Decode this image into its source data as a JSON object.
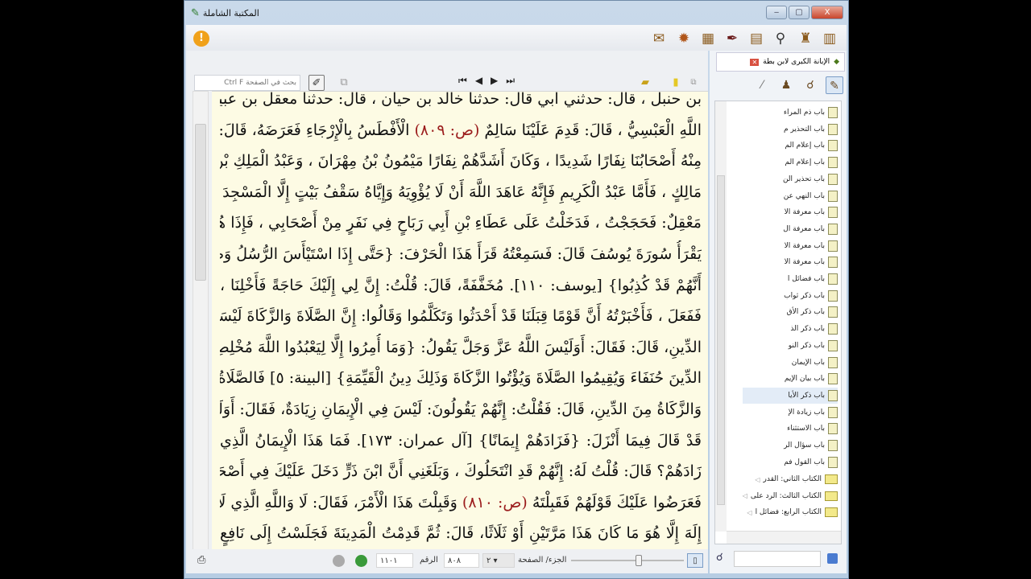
{
  "window": {
    "title": "المكتبة الشاملة",
    "controls": [
      "‒",
      "▢",
      "X"
    ]
  },
  "toolbar": {
    "icons": [
      "library-icon",
      "books-icon",
      "search-icon",
      "document-icon",
      "quill-icon",
      "index-icon",
      "settings-gear-icon",
      "notes-icon"
    ],
    "alert": "!"
  },
  "content_toolbar": {
    "search_placeholder": "بحث في الصفحة Ctrl F",
    "nav": [
      "⏮",
      "◀",
      "▶",
      "⏭"
    ]
  },
  "text_lines": [
    [
      {
        "t": "بن حنبل ، قال: حدثني أبي قال: حدثنا خالد بن حيان ، قال: حدثنا معقل بن عبيد"
      }
    ],
    [
      {
        "t": "اللَّهِ الْعَبْسِيُّ ، قَالَ: قَدِمَ عَلَيْنَا سَالِمٌ "
      },
      {
        "t": "(ص: ٨٠٩)",
        "red": true
      },
      {
        "t": " الْأَفْطَسُ بِالْإِرْجَاءِ فَعَرَضَهُ، قَالَ: فَنَفَرَ"
      }
    ],
    [
      {
        "t": "مِنْهُ أَصْحَابُنَا نِفَارًا شَدِيدًا ، وَكَانَ أَشَدَّهُمْ نِفَارًا مَيْمُونُ بْنُ مِهْرَانَ ، وَعَبْدُ الْمَلِكِ بْنُ"
      }
    ],
    [
      {
        "t": "مَالِكٍ ، فَأَمَّا عَبْدُ الْكَرِيمِ فَإِنَّهُ عَاهَدَ اللَّهَ أَنْ لَا يُؤْوِيَهُ وَإِيَّاهُ سَقْفُ بَيْتٍ إِلَّا الْمَسْجِدَ قَالَ"
      }
    ],
    [
      {
        "t": "مَعْقِلٌ: فَحَجَجْتُ ، فَدَخَلْتُ عَلَى عَطَاءِ بْنِ أَبِي رَبَاحٍ فِي نَفَرٍ مِنْ أَصْحَابِي ، فَإِذَا هُوَ"
      }
    ],
    [
      {
        "t": "يَقْرَأُ سُورَةَ يُوسُفَ قَالَ: فَسَمِعْتُهُ قَرَأَ هَذَا الْحَرْفَ: {حَتَّى إِذَا اسْتَيْأَسَ الرُّسُلُ وَظَنُّوا"
      }
    ],
    [
      {
        "t": "أَنَّهُمْ قَدْ كُذِبُوا} [يوسف: ١١٠]. مُخَفَّفَةً، قَالَ: قُلْتُ: إِنَّ لِي إِلَيْكَ حَاجَةً فَأَخْلِنَا ،"
      }
    ],
    [
      {
        "t": "فَفَعَلَ ، فَأَخْبَرْتُهُ أَنَّ قَوْمًا قِبَلَنَا قَدْ أَحْدَثُوا وَتَكَلَّمُوا وَقَالُوا: إِنَّ الصَّلَاةَ وَالزَّكَاةَ لَيْسَتَا مِنَ"
      }
    ],
    [
      {
        "t": "الدِّينِ، قَالَ: فَقَالَ: أَوَلَيْسَ اللَّهُ عَزَّ وَجَلَّ يَقُولُ: {وَمَا أُمِرُوا إِلَّا لِيَعْبُدُوا اللَّهَ مُخْلِصِينَ لَهُ"
      }
    ],
    [
      {
        "t": "الدِّينَ حُنَفَاءَ وَيُقِيمُوا الصَّلَاةَ وَيُؤْتُوا الزَّكَاةَ وَذَلِكَ دِينُ الْقَيِّمَةِ} [البينة: ٥] فَالصَّلَاةُ"
      }
    ],
    [
      {
        "t": "وَالزَّكَاةُ مِنَ الدِّينِ، قَالَ: فَقُلْتُ: إِنَّهُمْ يَقُولُونَ: لَيْسَ فِي الْإِيمَانِ زِيَادَةٌ، فَقَالَ: أَوَلَيْسَ"
      }
    ],
    [
      {
        "t": "قَدْ قَالَ فِيمَا أَنْزَلَ: {فَزَادَهُمْ إِيمَانًا} [آل عمران: ١٧٣]. فَمَا هَذَا الْإِيمَانُ الَّذِي"
      }
    ],
    [
      {
        "t": "زَادَهُمْ؟ قَالَ: قُلْتُ لَهُ: إِنَّهُمْ قَدِ انْتَحَلُوكَ ، وَبَلَغَنِي أَنَّ ابْنَ ذَرٍّ دَخَلَ عَلَيْكَ فِي أَصْحَابِهِ"
      }
    ],
    [
      {
        "t": "فَعَرَضُوا عَلَيْكَ قَوْلَهُمْ فَقَبِلْتَهُ "
      },
      {
        "t": "(ص: ٨١٠)",
        "red": true
      },
      {
        "t": " وَقَبِلْتَ هَذَا الْأَمْرَ، فَقَالَ: لَا وَاللَّهِ الَّذِي لَا"
      }
    ],
    [
      {
        "t": "إِلَهَ إِلَّا هُوَ مَا كَانَ هَذَا مَرَّتَيْنِ أَوْ ثَلَاثًا، قَالَ: ثُمَّ قَدِمْتُ الْمَدِينَةَ فَجَلَسْتُ إِلَى نَافِعٍ"
      }
    ]
  ],
  "status": {
    "part_page_label": "الجزء/ الصفحة",
    "part": "٢",
    "page": "٨٠٨",
    "number_label": "الرقم",
    "number": "١١٠١"
  },
  "side": {
    "book_tab": "الإبانة الكبرى لابن بطة",
    "tree": [
      "باب ذم المراء",
      "باب التحذير م",
      "باب إعلام الم",
      "باب إعلام الم",
      "باب تحذير الن",
      "باب النهي عن",
      "باب معرفة الا",
      "باب معرفة ال",
      "باب معرفة الا",
      "باب معرفة الا",
      "باب فضائل ا",
      "باب ذكر ثواب",
      "باب ذكر الأق",
      "باب ذكر الذ",
      "باب ذكر النو",
      "باب الإيمان",
      "باب بيان الإيم",
      "باب ذكر الأيا",
      "باب زيادة الإ",
      "باب الاستثناء",
      "باب سؤال الر",
      "باب القول فم"
    ],
    "selected_index": 17,
    "folders": [
      "الكتاب الثاني: القدر",
      "الكتاب الثالث: الرد على",
      "الكتاب الرابع: فضائل ا"
    ],
    "search_value": ""
  }
}
